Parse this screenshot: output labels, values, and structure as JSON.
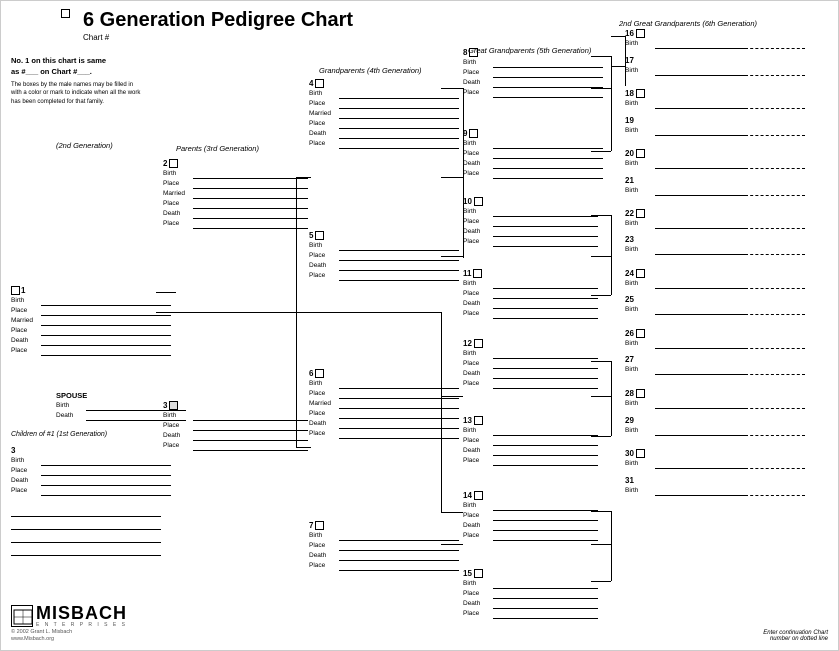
{
  "title": "6 Generation Pedigree Chart",
  "chartNum": "Chart #",
  "noOneLine": "No. 1 on this chart is same",
  "noOneLine2": "as #___ on Chart #___.",
  "smallNote": "The boxes by the male names may be filled in with a color or mark to indicate when all the work has been completed for that family.",
  "genLabels": {
    "gen2": "(2nd Generation)",
    "gen3": "Parents (3rd Generation)",
    "gen4": "Grandparents (4th Generation)",
    "gen5": "Great Grandparents (5th Generation)",
    "gen6": "2nd Great Grandparents (6th Generation)"
  },
  "spouse": {
    "label": "SPOUSE",
    "birth": "Birth",
    "death": "Death"
  },
  "children": "Children of #1 (1st Generation)",
  "fields": {
    "birth": "Birth",
    "place": "Place",
    "married": "Married",
    "death": "Death"
  },
  "bottomNote": "Enter continuation Chart\nnumber on dotted line",
  "logoName": "MISBACH",
  "logoSub": "E N T E R P R I S E S",
  "logoCopy": "© 2002 Grant L. Misbach",
  "logoWeb": "www.Misbach.org",
  "persons": [
    {
      "num": "1",
      "fields": [
        "Birth",
        "Place",
        "Married",
        "Place",
        "Death",
        "Place"
      ]
    },
    {
      "num": "2",
      "fields": [
        "Birth",
        "Place",
        "Married",
        "Place",
        "Death",
        "Place"
      ]
    },
    {
      "num": "3",
      "fields": [
        "Birth",
        "Place",
        "Death",
        "Place"
      ]
    },
    {
      "num": "4",
      "fields": [
        "Birth",
        "Place",
        "Married",
        "Place",
        "Death",
        "Place"
      ]
    },
    {
      "num": "5",
      "fields": [
        "Birth",
        "Place",
        "Death",
        "Place"
      ]
    },
    {
      "num": "6",
      "fields": [
        "Birth",
        "Place",
        "Married",
        "Place",
        "Death",
        "Place"
      ]
    },
    {
      "num": "7",
      "fields": [
        "Birth",
        "Place",
        "Death",
        "Place"
      ]
    },
    {
      "num": "8",
      "fields": [
        "Birth",
        "Place",
        "Death",
        "Place"
      ]
    },
    {
      "num": "9",
      "fields": [
        "Birth",
        "Place",
        "Death",
        "Place"
      ]
    },
    {
      "num": "10",
      "fields": [
        "Birth",
        "Place",
        "Death",
        "Place"
      ]
    },
    {
      "num": "11",
      "fields": [
        "Birth",
        "Place",
        "Death",
        "Place"
      ]
    },
    {
      "num": "12",
      "fields": [
        "Birth",
        "Place",
        "Death",
        "Place"
      ]
    },
    {
      "num": "13",
      "fields": [
        "Birth",
        "Place",
        "Death",
        "Place"
      ]
    },
    {
      "num": "14",
      "fields": [
        "Birth",
        "Place",
        "Death",
        "Place"
      ]
    },
    {
      "num": "15",
      "fields": [
        "Birth",
        "Place",
        "Death",
        "Place"
      ]
    }
  ]
}
